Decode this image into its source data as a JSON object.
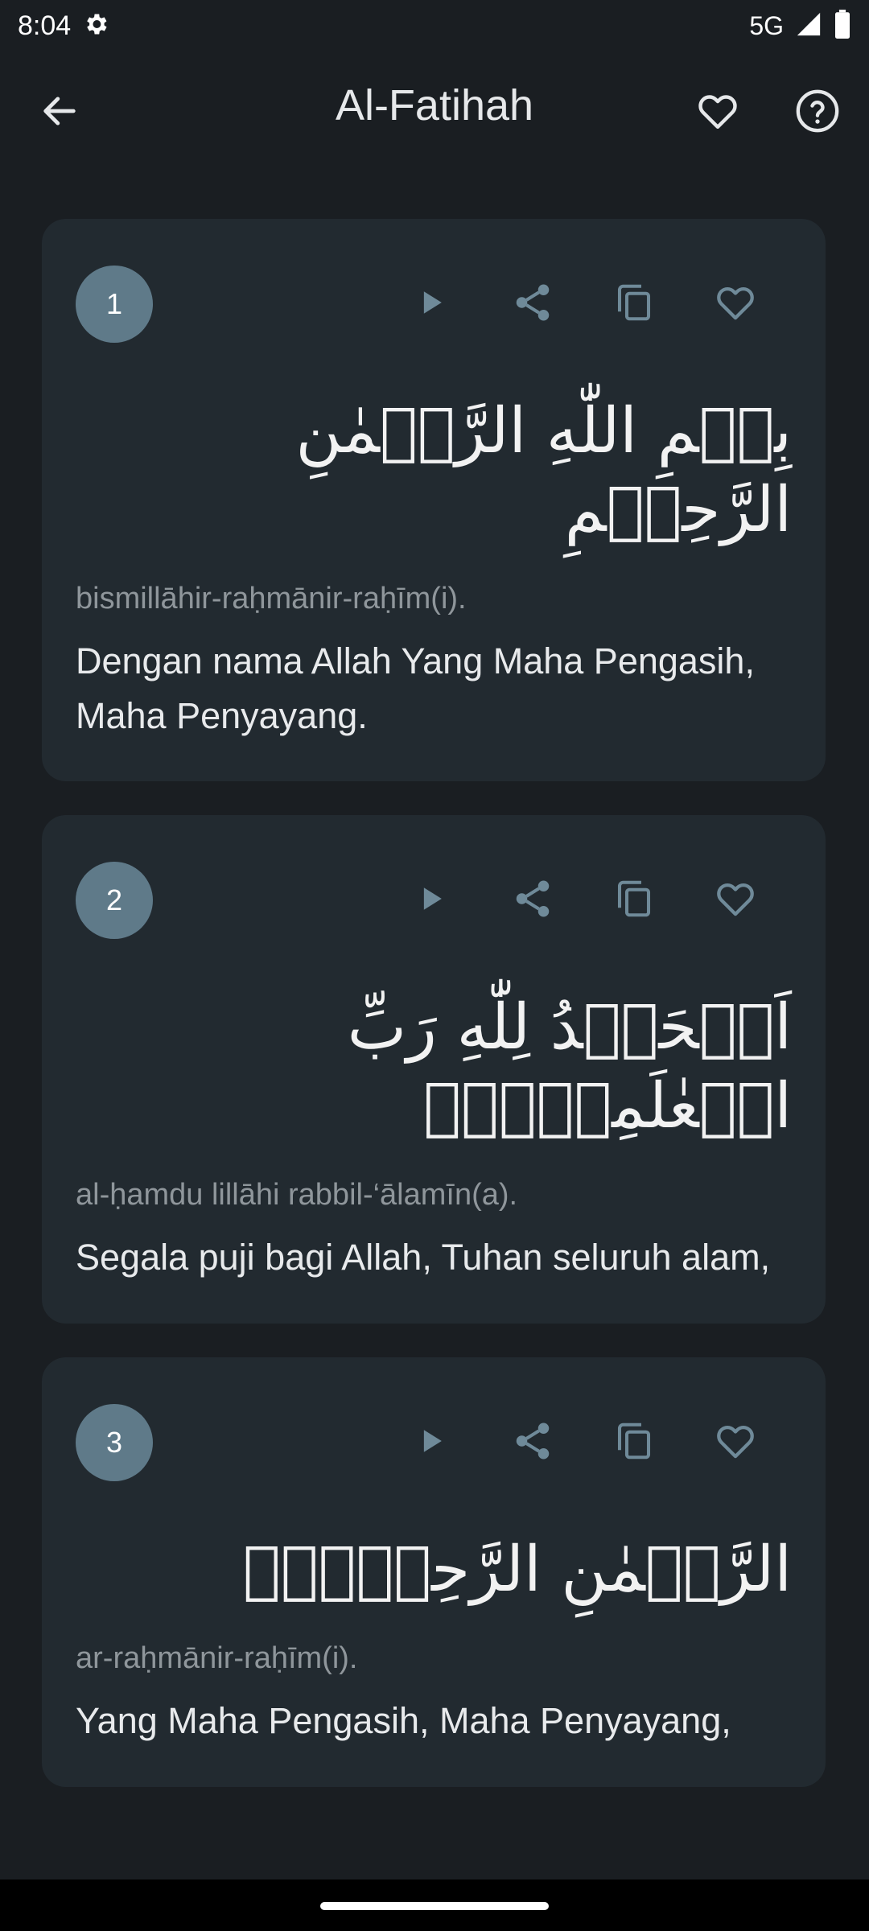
{
  "status_bar": {
    "time": "8:04",
    "network": "5G",
    "settings_icon": "gear-icon",
    "signal_icon": "signal-icon",
    "battery_icon": "battery-icon"
  },
  "app_bar": {
    "title": "Al-Fatihah",
    "back_icon": "arrow-left-icon",
    "favorite_icon": "heart-icon",
    "help_icon": "help-circle-icon"
  },
  "colors": {
    "background": "#1a1e22",
    "card": "#222a30",
    "badge": "#5f7a89",
    "action_icon": "#6f8a99"
  },
  "verses": [
    {
      "number": "1",
      "arabic": "بِسۡمِ اللّٰهِ الرَّحۡمٰنِ الرَّحِيۡمِ",
      "latin": "bismillāhir-raḥmānir-raḥīm(i).",
      "translation": "Dengan nama Allah Yang Maha Pengasih, Maha Penyayang."
    },
    {
      "number": "2",
      "arabic": "اَلۡحَمۡدُ لِلّٰهِ رَبِّ الۡعٰلَمِيۡنَۙ",
      "latin": "al-ḥamdu lillāhi rabbil-‘ālamīn(a).",
      "translation": "Segala puji bagi Allah, Tuhan seluruh alam,"
    },
    {
      "number": "3",
      "arabic": "الرَّحۡمٰنِ الرَّحِيۡمِۙ",
      "latin": "ar-raḥmānir-raḥīm(i).",
      "translation": "Yang Maha Pengasih, Maha Penyayang,"
    }
  ],
  "actions": [
    "play-icon",
    "share-icon",
    "copy-icon",
    "heart-icon"
  ]
}
